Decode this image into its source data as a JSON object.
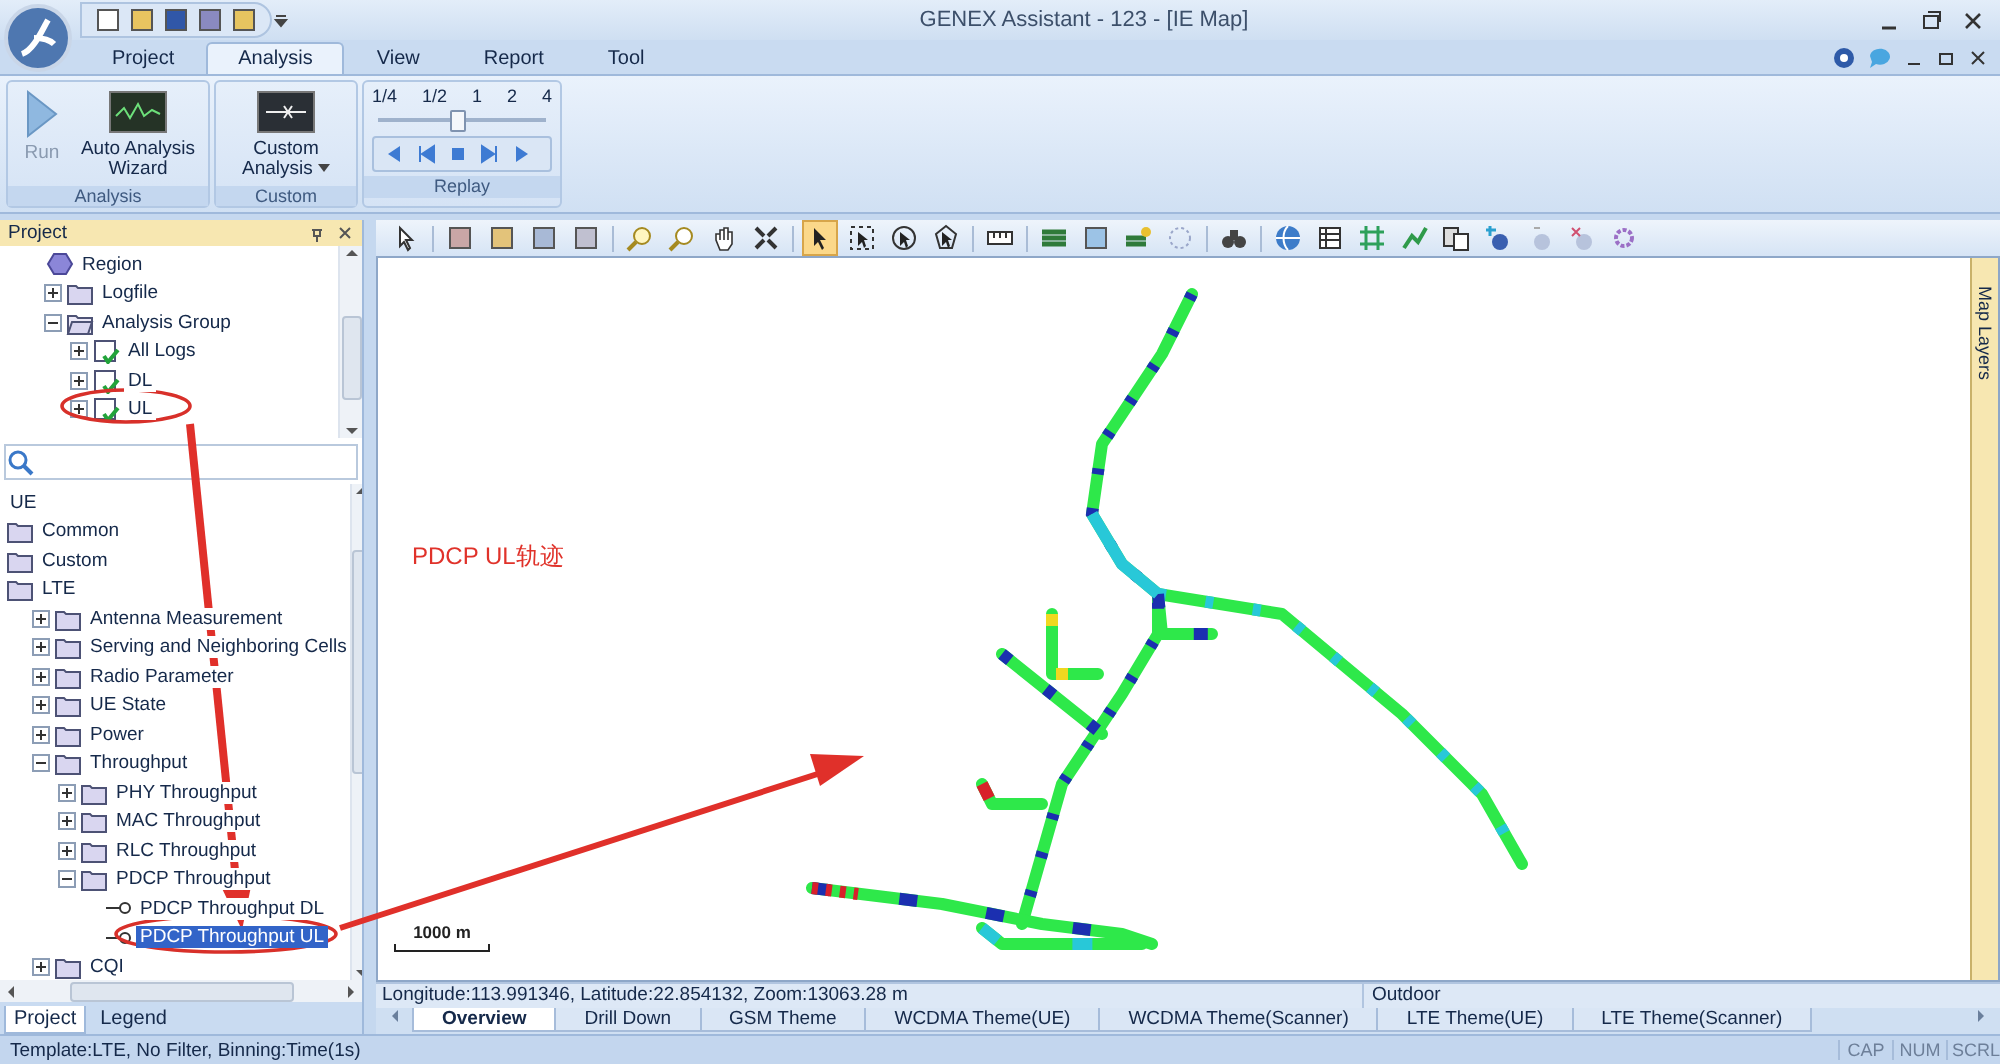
{
  "window": {
    "title": "GENEX Assistant - 123 - [IE Map]"
  },
  "ribbon_tabs": [
    {
      "label": "Project",
      "selected": false
    },
    {
      "label": "Analysis",
      "selected": true
    },
    {
      "label": "View",
      "selected": false
    },
    {
      "label": "Report",
      "selected": false
    },
    {
      "label": "Tool",
      "selected": false
    }
  ],
  "ribbon_groups": [
    {
      "title": "Analysis",
      "kind": "buttons",
      "buttons": [
        {
          "label": "Run",
          "kind": "play",
          "disabled": true
        },
        {
          "label": "Auto Analysis Wizard",
          "kind": "wizard",
          "disabled": false
        }
      ]
    },
    {
      "title": "Custom",
      "kind": "buttons",
      "buttons": [
        {
          "label": "Custom Analysis",
          "kind": "custom",
          "disabled": false,
          "dropdown": true
        }
      ]
    },
    {
      "title": "Replay",
      "kind": "replay",
      "speeds": [
        "1/4",
        "1/2",
        "1",
        "2",
        "4"
      ],
      "level": 0.48
    }
  ],
  "panel": {
    "title": "Project",
    "project_tree": [
      {
        "label": "Region",
        "kind": "region",
        "selected": false
      },
      {
        "label": "Logfile",
        "kind": "folder",
        "expanded": false,
        "selected": false
      },
      {
        "label": "Analysis Group",
        "kind": "group",
        "expanded": true,
        "selected": false,
        "children": [
          {
            "label": "All Logs",
            "kind": "log",
            "expanded": false,
            "selected": false
          },
          {
            "label": "DL",
            "kind": "log",
            "expanded": false,
            "selected": false
          },
          {
            "label": "UL",
            "kind": "log",
            "expanded": false,
            "selected": false
          }
        ]
      }
    ],
    "parameter_tree": [
      {
        "label": "UE",
        "kind": "category",
        "selected": false
      },
      {
        "label": "Common",
        "kind": "folder",
        "selected": false
      },
      {
        "label": "Custom",
        "kind": "folder",
        "selected": false
      },
      {
        "label": "LTE",
        "kind": "folder",
        "selected": false,
        "children": [
          {
            "label": "Antenna Measurement",
            "kind": "folder",
            "expanded": false,
            "selected": false
          },
          {
            "label": "Serving and Neighboring Cells",
            "kind": "folder",
            "expanded": false,
            "selected": false
          },
          {
            "label": "Radio Parameter",
            "kind": "folder",
            "expanded": false,
            "selected": false
          },
          {
            "label": "UE State",
            "kind": "folder",
            "expanded": false,
            "selected": false
          },
          {
            "label": "Power",
            "kind": "folder",
            "expanded": false,
            "selected": false
          },
          {
            "label": "Throughput",
            "kind": "folder",
            "expanded": true,
            "selected": false,
            "children": [
              {
                "label": "PHY Throughput",
                "kind": "folder",
                "expanded": false,
                "selected": false
              },
              {
                "label": "MAC Throughput",
                "kind": "folder",
                "expanded": false,
                "selected": false
              },
              {
                "label": "RLC Throughput",
                "kind": "folder",
                "expanded": false,
                "selected": false
              },
              {
                "label": "PDCP Throughput",
                "kind": "folder",
                "expanded": true,
                "selected": false,
                "children": [
                  {
                    "label": "PDCP Throughput DL",
                    "kind": "parameter",
                    "selected": false
                  },
                  {
                    "label": "PDCP Throughput UL",
                    "kind": "parameter",
                    "selected": true
                  }
                ]
              }
            ]
          },
          {
            "label": "CQI",
            "kind": "folder",
            "expanded": false,
            "selected": false
          }
        ]
      }
    ],
    "tabs": [
      {
        "label": "Project",
        "selected": true
      },
      {
        "label": "Legend",
        "selected": false
      }
    ]
  },
  "map": {
    "selection_tools": [
      {
        "selected": true
      },
      {
        "selected": false
      },
      {
        "selected": false
      },
      {
        "selected": false
      }
    ],
    "annotation": "PDCP UL轨迹",
    "scale": "1000 m",
    "side_tab": "Map Layers"
  },
  "map_status": {
    "position": "Longitude:113.991346, Latitude:22.854132, Zoom:13063.28 m",
    "environment": "Outdoor"
  },
  "theme_tabs": [
    {
      "label": "Overview",
      "selected": true
    },
    {
      "label": "Drill Down",
      "selected": false
    },
    {
      "label": "GSM Theme",
      "selected": false
    },
    {
      "label": "WCDMA Theme(UE)",
      "selected": false
    },
    {
      "label": "WCDMA Theme(Scanner)",
      "selected": false
    },
    {
      "label": "LTE Theme(UE)",
      "selected": false
    },
    {
      "label": "LTE Theme(Scanner)",
      "selected": false
    }
  ],
  "status_bar": {
    "text": "Template:LTE,  No Filter,  Binning:Time(1s)",
    "indicators": [
      "CAP",
      "NUM",
      "SCRL"
    ]
  }
}
